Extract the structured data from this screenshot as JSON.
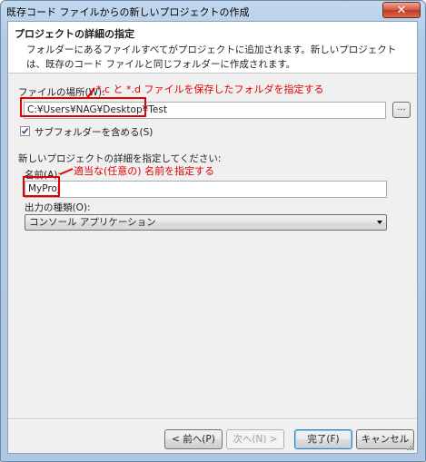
{
  "window": {
    "title": "既存コード ファイルからの新しいプロジェクトの作成",
    "close_glyph": "✕"
  },
  "header": {
    "title": "プロジェクトの詳細の指定",
    "description": "フォルダーにあるファイルすべてがプロジェクトに追加されます。新しいプロジェクトは、既存のコード ファイルと同じフォルダーに作成されます。"
  },
  "location": {
    "label": "ファイルの場所(W):",
    "value": "C:¥Users¥NAG¥Desktop¥Test",
    "browse_label": "...",
    "include_subfolders_label": "サブフォルダーを含める(S)",
    "include_subfolders_checked": true
  },
  "details": {
    "section_label": "新しいプロジェクトの詳細を指定してください:",
    "name_label": "名前(A):",
    "name_value": "MyProj",
    "output_label": "出力の種類(O):",
    "output_value": "コンソール アプリケーション"
  },
  "annotations": {
    "location_note": "*.c と *.d ファイルを保存したフォルダを指定する",
    "name_note": "適当な(任意の) 名前を指定する",
    "color": "#e30000"
  },
  "buttons": {
    "back": "< 前へ(P)",
    "next": "次へ(N) >",
    "finish": "完了(F)",
    "cancel": "キャンセル"
  },
  "icons": {
    "close": "close-icon",
    "checkmark": "checkmark-icon",
    "dropdown": "chevron-down-icon",
    "resize_grip": "resize-grip-icon"
  }
}
